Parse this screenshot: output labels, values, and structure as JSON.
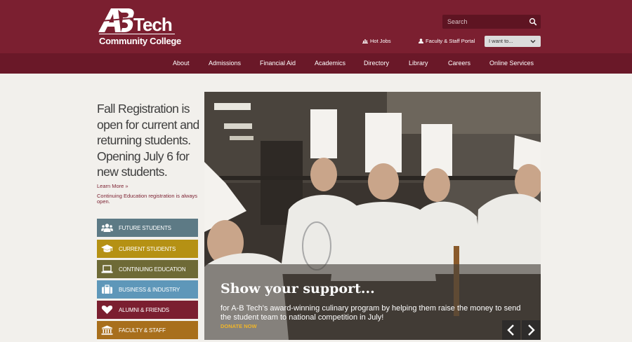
{
  "header": {
    "logo_text": "AB Tech",
    "logo_sub": "Community College",
    "search_placeholder": "Search",
    "hot_jobs": "Hot Jobs",
    "faculty_portal": "Faculty & Staff Portal",
    "i_want_to": "I want to..."
  },
  "nav": [
    "About",
    "Admissions",
    "Financial Aid",
    "Academics",
    "Directory",
    "Library",
    "Careers",
    "Online Services"
  ],
  "promo": {
    "headline": "Fall Registration is open for current and returning students. Opening July 6 for new students.",
    "learn_more": "Learn More »",
    "note": "Continuing Education registration is always open."
  },
  "audiences": [
    {
      "label": "FUTURE STUDENTS",
      "icon": "group-icon",
      "color": "#5d7a85"
    },
    {
      "label": "CURRENT STUDENTS",
      "icon": "graduation-cap-icon",
      "color": "#b59114"
    },
    {
      "label": "CONTINUING EDUCATION",
      "icon": "laptop-icon",
      "color": "#6e6a36"
    },
    {
      "label": "BUSINESS & INDUSTRY",
      "icon": "briefcase-icon",
      "color": "#5e97b9"
    },
    {
      "label": "ALUMNI & FRIENDS",
      "icon": "heart-icon",
      "color": "#7b1f30"
    },
    {
      "label": "FACULTY & STAFF",
      "icon": "institution-icon",
      "color": "#a86f1c"
    }
  ],
  "hero": {
    "title": "Show your support...",
    "body": "for A-B Tech's award-winning culinary program by helping them raise the money to send the student team to national competition in July!",
    "cta": "DONATE NOW"
  },
  "colors": {
    "brand": "#7b1f30",
    "nav": "#6a1828",
    "accent": "#f0b529",
    "background": "#f2f0ec"
  }
}
